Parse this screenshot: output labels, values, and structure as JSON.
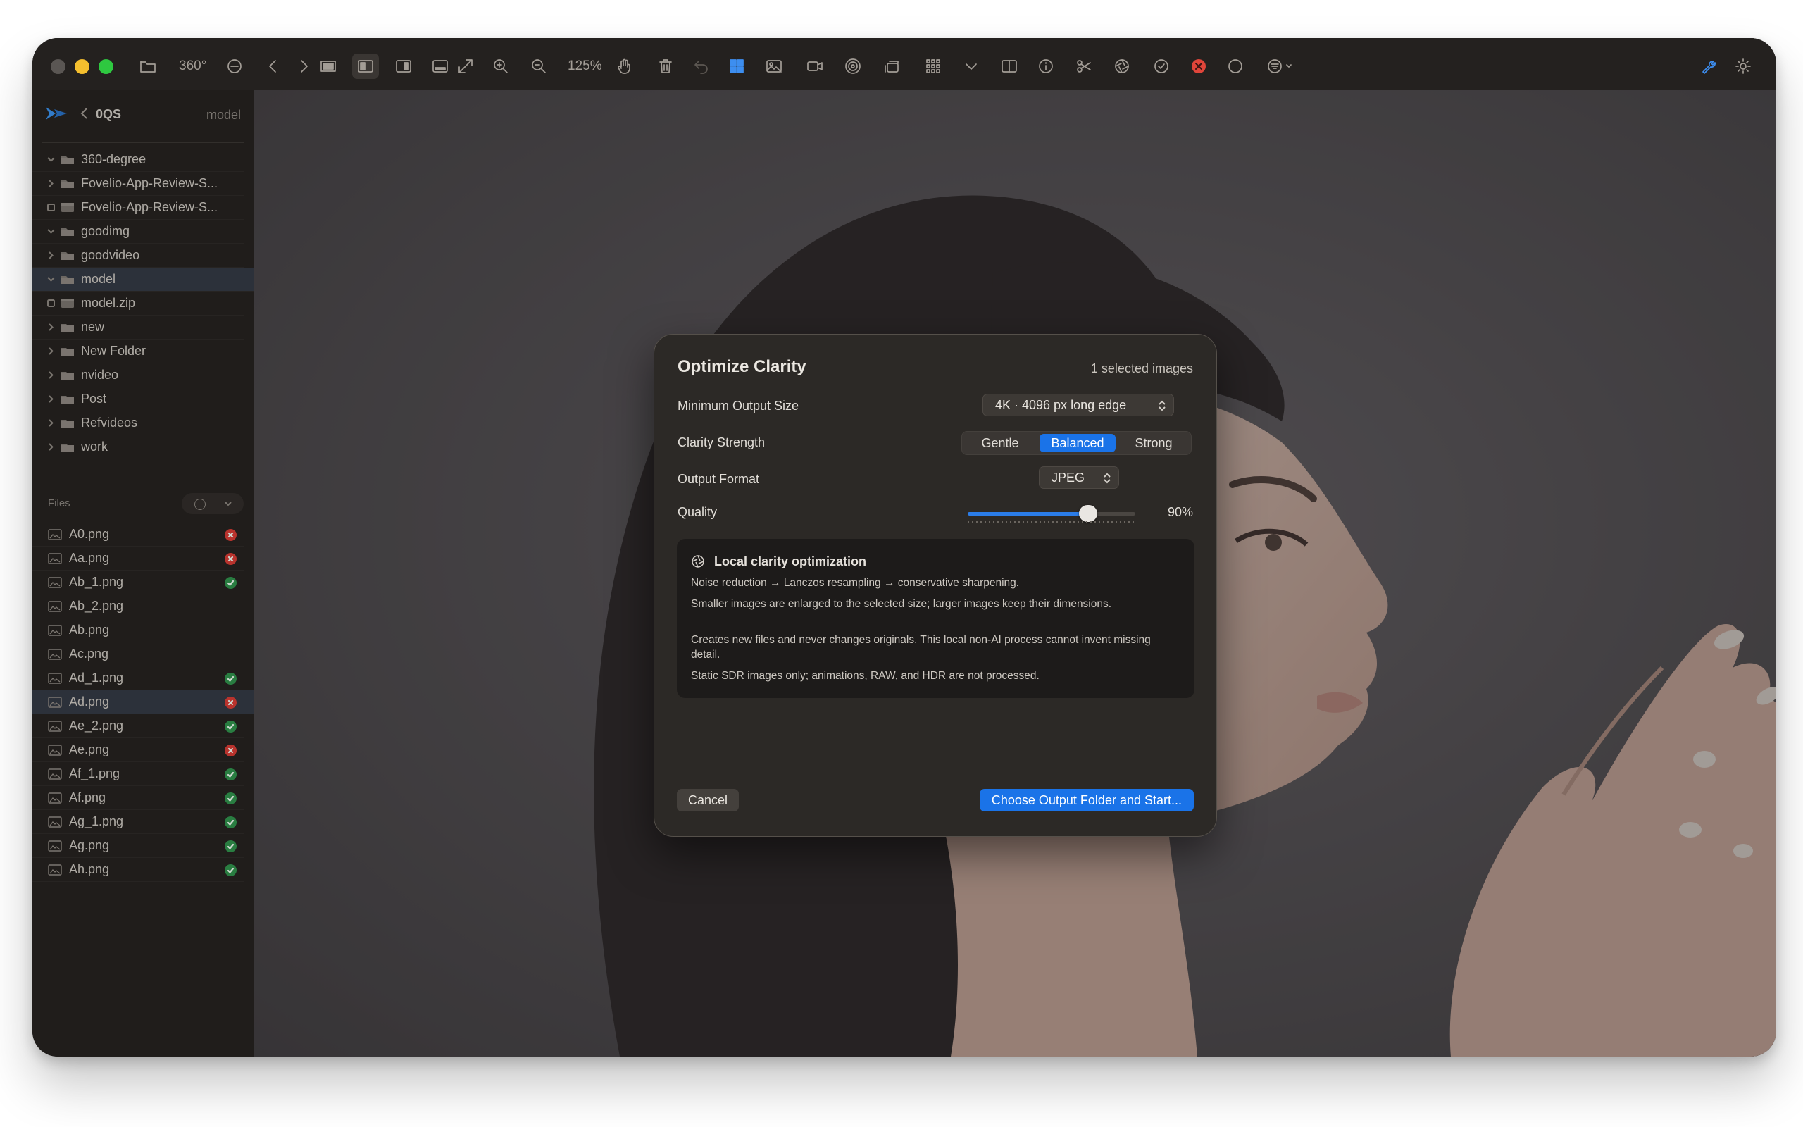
{
  "toolbar": {
    "view_360_label": "360°",
    "zoom_label": "125%"
  },
  "sidebar": {
    "title": "0QS",
    "breadcrumb": "model",
    "tree": [
      {
        "label": "360-degree",
        "kind": "folder",
        "chevron": "down"
      },
      {
        "label": "Fovelio-App-Review-S...",
        "kind": "folder",
        "chevron": "right"
      },
      {
        "label": "Fovelio-App-Review-S...",
        "kind": "archive",
        "chevron": "none"
      },
      {
        "label": "goodimg",
        "kind": "folder",
        "chevron": "down"
      },
      {
        "label": "goodvideo",
        "kind": "folder",
        "chevron": "right"
      },
      {
        "label": "model",
        "kind": "folder",
        "chevron": "down",
        "selected": true
      },
      {
        "label": "model.zip",
        "kind": "archive",
        "chevron": "none"
      },
      {
        "label": "new",
        "kind": "folder",
        "chevron": "right"
      },
      {
        "label": "New Folder",
        "kind": "folder",
        "chevron": "right"
      },
      {
        "label": "nvideo",
        "kind": "folder",
        "chevron": "right"
      },
      {
        "label": "Post",
        "kind": "folder",
        "chevron": "right"
      },
      {
        "label": "Refvideos",
        "kind": "folder",
        "chevron": "right"
      },
      {
        "label": "work",
        "kind": "folder",
        "chevron": "right"
      }
    ],
    "files_label": "Files",
    "files": [
      {
        "name": "A0.png",
        "status": "err"
      },
      {
        "name": "Aa.png",
        "status": "err"
      },
      {
        "name": "Ab_1.png",
        "status": "ok"
      },
      {
        "name": "Ab_2.png",
        "status": "none"
      },
      {
        "name": "Ab.png",
        "status": "none"
      },
      {
        "name": "Ac.png",
        "status": "none"
      },
      {
        "name": "Ad_1.png",
        "status": "ok"
      },
      {
        "name": "Ad.png",
        "status": "err",
        "selected": true
      },
      {
        "name": "Ae_2.png",
        "status": "ok"
      },
      {
        "name": "Ae.png",
        "status": "err"
      },
      {
        "name": "Af_1.png",
        "status": "ok"
      },
      {
        "name": "Af.png",
        "status": "ok"
      },
      {
        "name": "Ag_1.png",
        "status": "ok"
      },
      {
        "name": "Ag.png",
        "status": "ok"
      },
      {
        "name": "Ah.png",
        "status": "ok"
      }
    ]
  },
  "dialog": {
    "title": "Optimize Clarity",
    "selection_count": "1 selected images",
    "min_output_label": "Minimum Output Size",
    "min_output_value": "4K · 4096 px long edge",
    "strength_label": "Clarity Strength",
    "strength_options": [
      "Gentle",
      "Balanced",
      "Strong"
    ],
    "strength_selected": "Balanced",
    "format_label": "Output Format",
    "format_value": "JPEG",
    "quality_label": "Quality",
    "quality_value": "90%",
    "quality_fraction": 0.72,
    "info_title": "Local clarity optimization",
    "info_lines": [
      "Noise reduction → Lanczos resampling → conservative sharpening.",
      "Smaller images are enlarged to the selected size; larger images keep their dimensions.",
      "Creates new files and never changes originals. This local non-AI process cannot invent missing detail.",
      "Static SDR images only; animations, RAW, and HDR are not processed."
    ],
    "cancel_label": "Cancel",
    "start_label": "Choose Output Folder and Start..."
  },
  "colors": {
    "accent": "#1a73e8",
    "status_ok": "#2f8f4a",
    "status_err": "#d23b34"
  }
}
